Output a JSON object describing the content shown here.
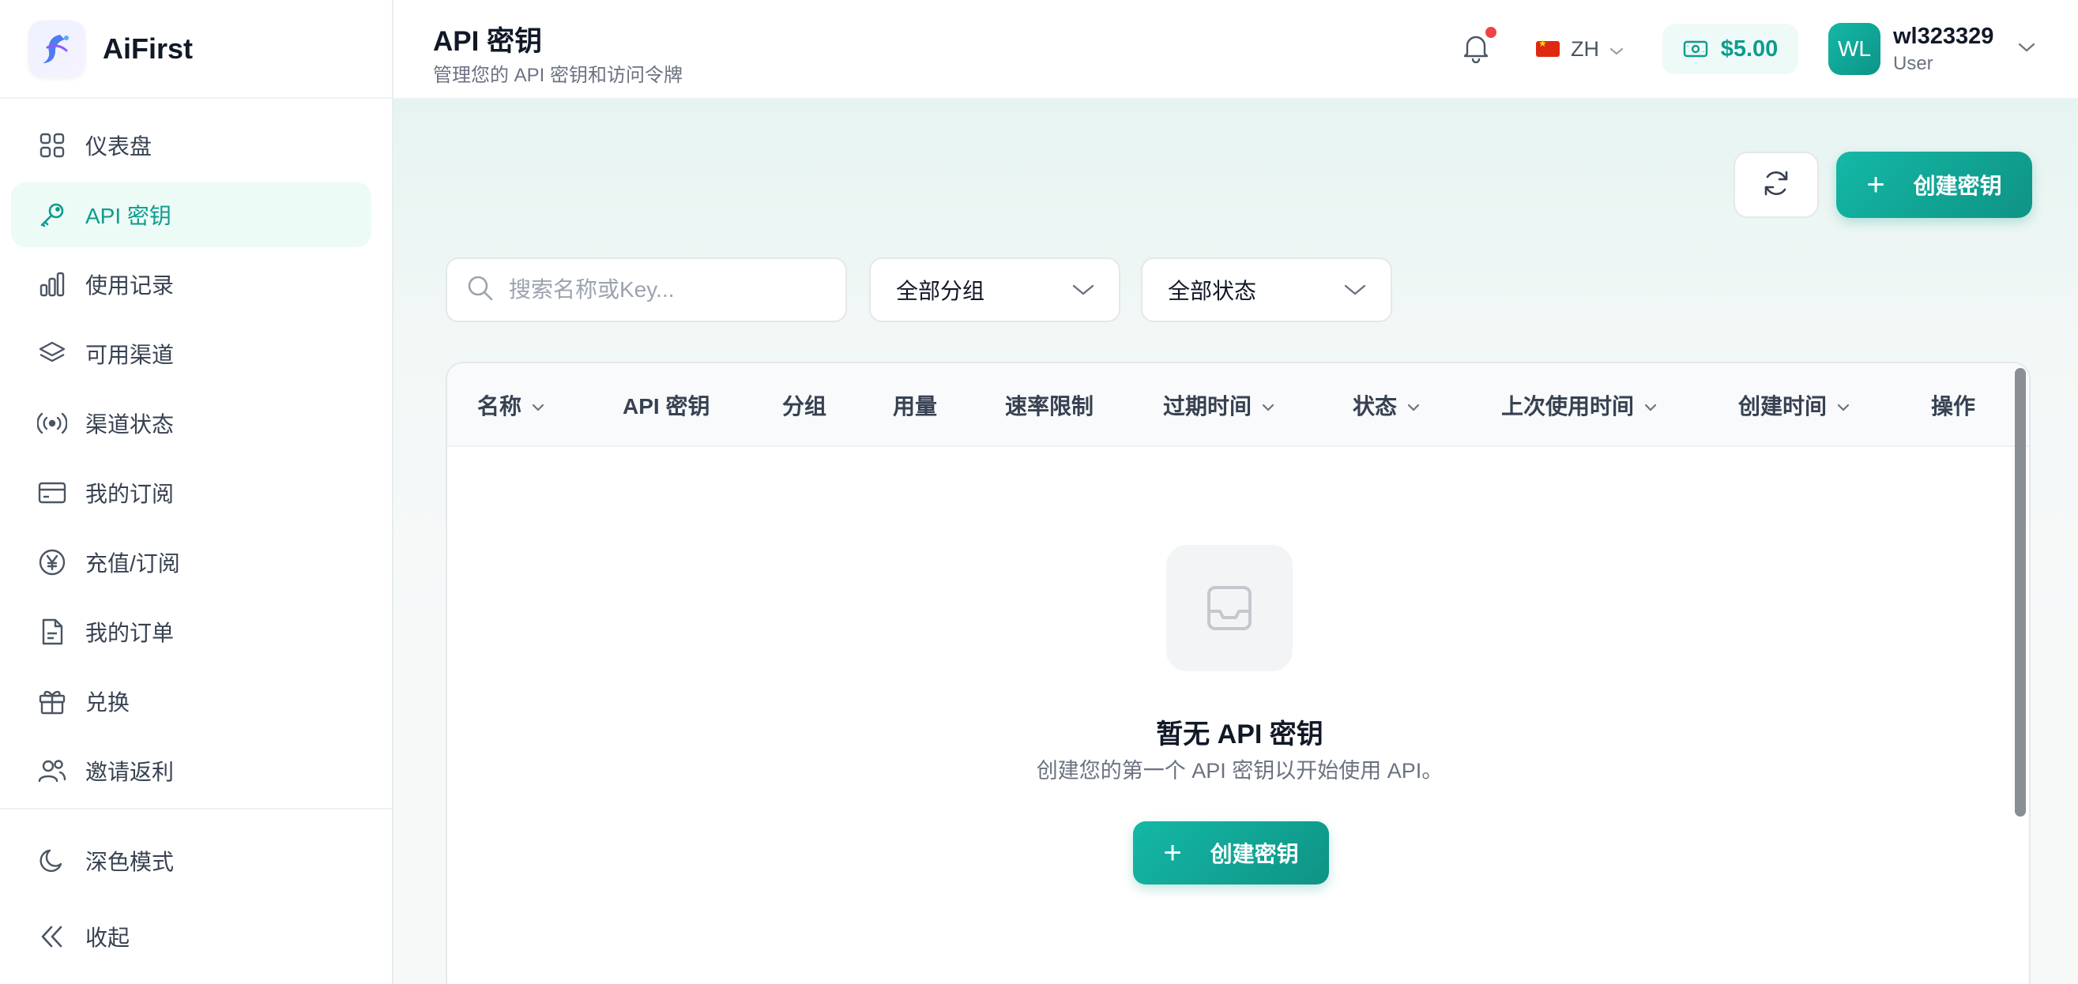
{
  "brand": {
    "name": "AiFirst"
  },
  "sidebar": {
    "items": [
      {
        "label": "仪表盘",
        "icon": "dashboard-icon"
      },
      {
        "label": "API 密钥",
        "icon": "key-icon",
        "active": true
      },
      {
        "label": "使用记录",
        "icon": "bar-chart-icon"
      },
      {
        "label": "可用渠道",
        "icon": "layers-icon"
      },
      {
        "label": "渠道状态",
        "icon": "signal-icon"
      },
      {
        "label": "我的订阅",
        "icon": "credit-card-icon"
      },
      {
        "label": "充值/订阅",
        "icon": "yen-icon"
      },
      {
        "label": "我的订单",
        "icon": "document-icon"
      },
      {
        "label": "兑换",
        "icon": "gift-icon"
      },
      {
        "label": "邀请返利",
        "icon": "users-icon"
      }
    ],
    "dark_mode_label": "深色模式",
    "collapse_label": "收起"
  },
  "header": {
    "title": "API 密钥",
    "subtitle": "管理您的 API 密钥和访问令牌",
    "language": "ZH",
    "balance": "$5.00",
    "user": {
      "initials": "WL",
      "name": "wl323329",
      "role": "User"
    }
  },
  "toolbar": {
    "create_label": "创建密钥",
    "search_placeholder": "搜索名称或Key...",
    "group_filter": "全部分组",
    "status_filter": "全部状态"
  },
  "table": {
    "columns": [
      "名称",
      "API 密钥",
      "分组",
      "用量",
      "速率限制",
      "过期时间",
      "状态",
      "上次使用时间",
      "创建时间",
      "操作"
    ]
  },
  "empty_state": {
    "title": "暂无 API 密钥",
    "description": "创建您的第一个 API 密钥以开始使用 API。",
    "button_label": "创建密钥"
  },
  "colors": {
    "accent": "#14b8a6",
    "accent_dark": "#0f9385",
    "notification": "#ef4444"
  }
}
